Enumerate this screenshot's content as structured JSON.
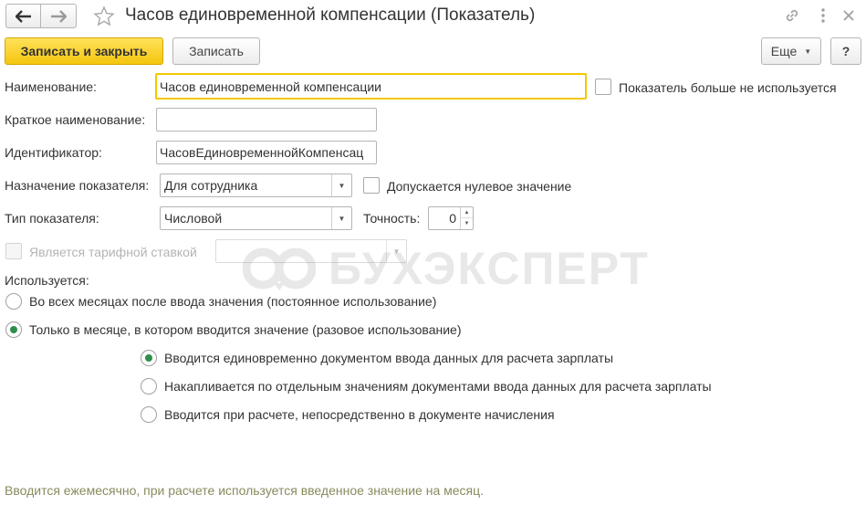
{
  "window": {
    "title": "Часов единовременной компенсации (Показатель)"
  },
  "toolbar": {
    "save_close_label": "Записать и закрыть",
    "save_label": "Записать",
    "more_label": "Еще",
    "help_label": "?"
  },
  "form": {
    "name_label": "Наименование:",
    "name_value": "Часов единовременной компенсации",
    "not_used_label": "Показатель больше не используется",
    "short_name_label": "Краткое наименование:",
    "short_name_value": "",
    "identifier_label": "Идентификатор:",
    "identifier_value": "ЧасовЕдиновременнойКомпенсац",
    "purpose_label": "Назначение показателя:",
    "purpose_value": "Для сотрудника",
    "zero_allowed_label": "Допускается нулевое значение",
    "type_label": "Тип показателя:",
    "type_value": "Числовой",
    "precision_label": "Точность:",
    "precision_value": "0",
    "tariff_label": "Является тарифной ставкой",
    "usage_label": "Используется:",
    "usage_options": [
      "Во всех месяцах после ввода значения (постоянное использование)",
      "Только в месяце, в котором вводится значение (разовое использование)"
    ],
    "input_options": [
      "Вводится единовременно документом ввода данных для расчета зарплаты",
      "Накапливается по отдельным значениям документами ввода данных для расчета зарплаты",
      "Вводится при расчете, непосредственно в документе начисления"
    ]
  },
  "watermark": {
    "text": "БУХЭКСПЕРТ"
  },
  "footer": {
    "hint": "Вводится ежемесячно, при расчете используется введенное значение на месяц."
  },
  "colors": {
    "accent": "#f5c60f",
    "radio_selected": "#2e8f4a",
    "hint_text": "#8a8a5e"
  },
  "icons": {
    "back": "arrow-left-icon",
    "forward": "arrow-right-icon",
    "favorite": "star-icon",
    "link": "link-icon",
    "menu": "kebab-menu-icon",
    "close": "close-icon"
  }
}
